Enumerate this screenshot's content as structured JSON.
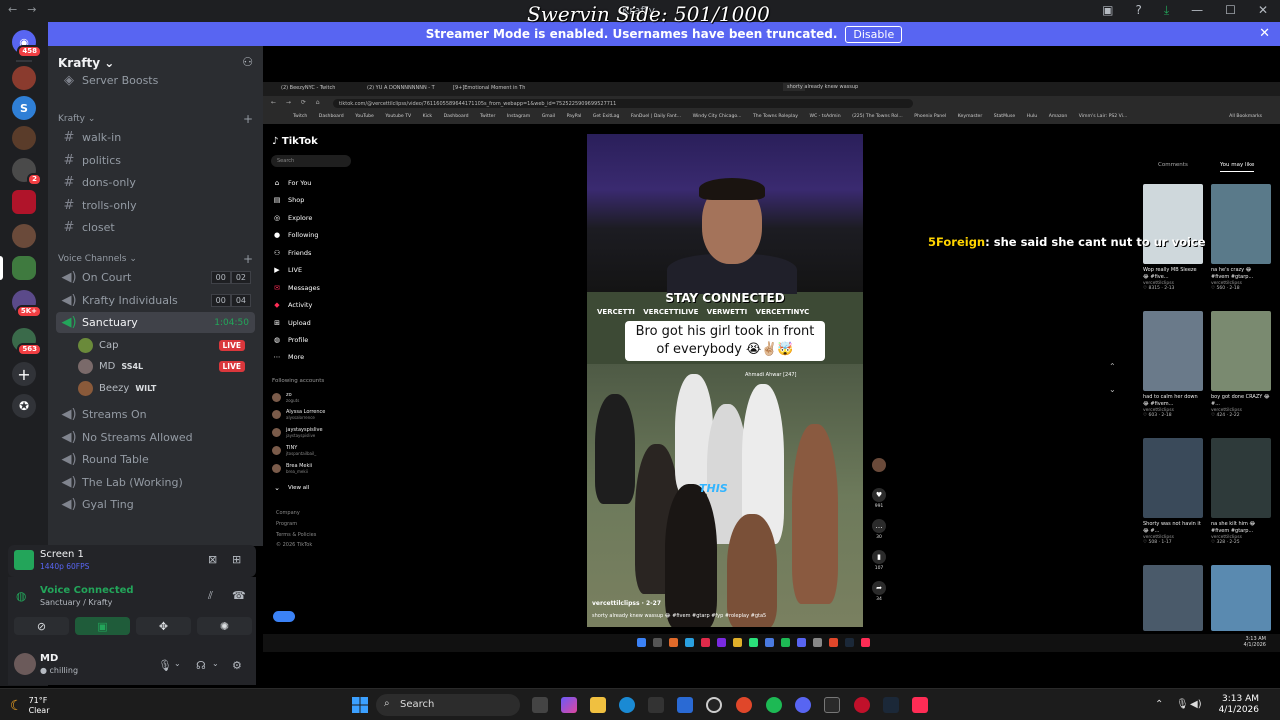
{
  "overlay": {
    "title": "Swervin Side: 501/1000",
    "chat_name": "5Foreign",
    "chat_text": ": she said she cant nut to ur voice"
  },
  "titlebar": {
    "center": "Krafty"
  },
  "banner": {
    "text": "Streamer Mode is enabled. Usernames have been truncated.",
    "button": "Disable"
  },
  "servers": {
    "badge_top": "458",
    "badge_b": "2",
    "badge_c": "5K+",
    "badge_d": "563"
  },
  "sidebar": {
    "server_name": "Krafty",
    "boosts": "Server Boosts",
    "category": "Krafty",
    "text_channels": [
      "walk-in",
      "politics",
      "dons-only",
      "trolls-only",
      "closet"
    ],
    "voice_category": "Voice Channels",
    "voice_channels": [
      {
        "name": "On Court",
        "c1": "00",
        "c2": "02"
      },
      {
        "name": "Krafty Individuals",
        "c1": "00",
        "c2": "04"
      },
      {
        "name": "Sanctuary",
        "time": "1:04:50"
      }
    ],
    "voice_users": [
      {
        "name": "Cap",
        "live": "LIVE"
      },
      {
        "name": "MD",
        "tag": "SS4L",
        "live": "LIVE"
      },
      {
        "name": "Beezy",
        "tag": "WILT"
      }
    ],
    "more_channels": [
      "Streams On",
      "No Streams Allowed",
      "Round Table",
      "The Lab (Working)",
      "Gyal Ting"
    ]
  },
  "screen_panel": {
    "title": "Screen 1",
    "sub": "1440p 60FPS"
  },
  "voice_panel": {
    "status": "Voice Connected",
    "where": "Sanctuary / Krafty"
  },
  "user_panel": {
    "name": "MD",
    "status": "chilling"
  },
  "browser": {
    "tabs": [
      "(2) BeezyNYC - Twitch",
      "(2) YU A DONNNNNNNN - T",
      "[9+]Emotional Moment in Th",
      "shorty already knew wassup"
    ],
    "url": "tiktok.com/@vercettilclipss/video/7611605589644171105s_from_webapp=1&web_id=7525225909699527711",
    "bookmarks": [
      "Twitch",
      "Dashboard",
      "YouTube",
      "Youtube TV",
      "Kick",
      "Dashboard",
      "Twitter",
      "Instagram",
      "Gmail",
      "PayPal",
      "Get ExitLag",
      "FanDuel | Daily Fant...",
      "Windy City Chicago...",
      "The Towns Roleplay",
      "WC - tsAdmin",
      "(225) The Towns Rol...",
      "Phoenix Panel",
      "Keymaster",
      "StatMuse",
      "Hulu",
      "Amazon",
      "Vimm's Lair: PS2 Vi..."
    ],
    "all_bookmarks": "All Bookmarks"
  },
  "tiktok": {
    "logo": "TikTok",
    "search_placeholder": "Search",
    "nav": [
      "For You",
      "Shop",
      "Explore",
      "Following",
      "Friends",
      "LIVE",
      "Messages",
      "Activity",
      "Upload",
      "Profile",
      "More"
    ],
    "following_title": "Following accounts",
    "accounts": [
      {
        "name": "zo",
        "handle": "zoguts"
      },
      {
        "name": "Alyssa Lorrence",
        "handle": "alyssalorrence"
      },
      {
        "name": "jaystayspislive",
        "handle": "jaystayspislive"
      },
      {
        "name": "TINY",
        "handle": "jtospantailbail_"
      },
      {
        "name": "Brea Mekii",
        "handle": "brea_mekii"
      }
    ],
    "view_all": "View all",
    "footer": [
      "Company",
      "Program",
      "Terms & Policies",
      "© 2026 TikTok"
    ],
    "video": {
      "stay": "STAY CONNECTED",
      "socials": [
        "VERCETTI",
        "VERCETTILIVE",
        "VERWETTI",
        "VERCETTINYC"
      ],
      "caption": "Bro got his girl took in front of everybody 😭✌🏼🤯",
      "this": "THIS",
      "plate": "Ahmadi Ahwar [247]",
      "user": "vercettilclipss · 2-27",
      "desc": "shorty already knew wassup 😂 #fivem #gtarp #fyp #roleplay #gta5"
    },
    "actions": [
      {
        "icon": "♥",
        "n": "991"
      },
      {
        "icon": "…",
        "n": "30"
      },
      {
        "icon": "▮",
        "n": "107"
      },
      {
        "icon": "➦",
        "n": "34"
      }
    ],
    "right_tabs": [
      "Comments",
      "You may like"
    ],
    "grid": [
      {
        "text": "Wop really MB Sleeze 😂 #five...",
        "user": "vercettilclipss",
        "stats": "♡ 8315 · 2-13"
      },
      {
        "text": "na he's crazy 😂 #fivem #gtarp...",
        "user": "vercettilclipss",
        "stats": "♡ 560 · 2-18"
      },
      {
        "text": "had to calm her down 😂 #fivem...",
        "user": "vercettilclipss",
        "stats": "♡ 603 · 2-18"
      },
      {
        "text": "boy got done CRAZY 😂 #...",
        "user": "vercettilclipss",
        "stats": "♡ 424 · 2-22"
      },
      {
        "text": "Shorty was not havin it 😂 #...",
        "user": "vercettilclipss",
        "stats": "♡ 508 · 1-17"
      },
      {
        "text": "na she kilt him 😂 #fivem #gtarp...",
        "user": "vercettilclipss",
        "stats": "♡ 328 · 2-25"
      }
    ]
  },
  "inner_clock": {
    "time": "3:13 AM",
    "date": "4/1/2026"
  },
  "taskbar": {
    "weather_temp": "71°F",
    "weather_desc": "Clear",
    "search": "Search",
    "time": "3:13 AM",
    "date": "4/1/2026"
  }
}
